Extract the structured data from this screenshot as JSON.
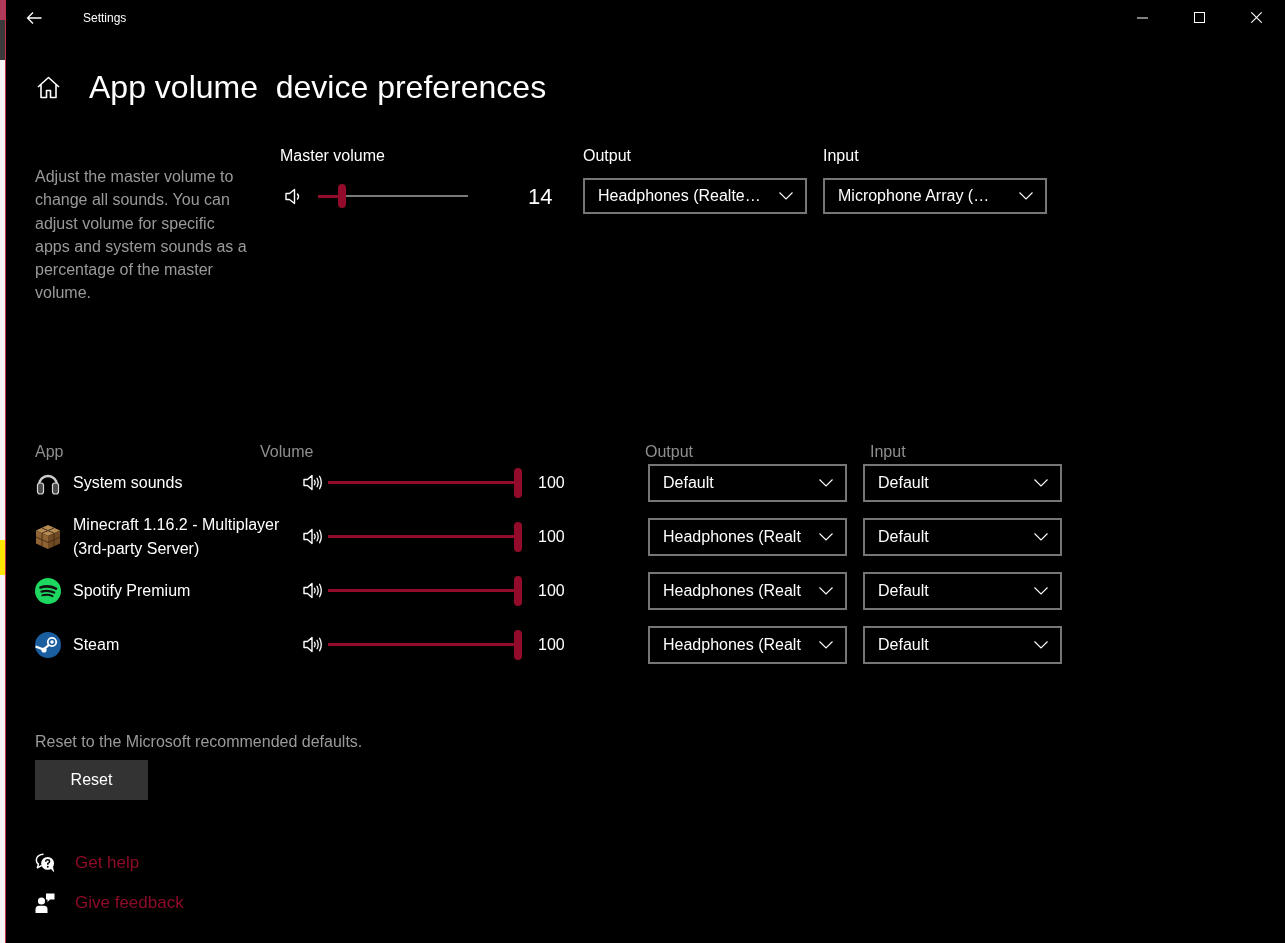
{
  "window": {
    "title": "Settings"
  },
  "page_title": "App volume  device preferences",
  "master": {
    "description": "Adjust the master volume to change all sounds. You can adjust volume for specific apps and system sounds as a percentage of the master volume.",
    "label": "Master volume",
    "level": 0.14,
    "reading": "14",
    "output": {
      "label": "Output",
      "value": "Headphones (Realte…"
    },
    "input": {
      "label": "Input",
      "value": "Microphone Array (…"
    }
  },
  "apps": {
    "columns": [
      "App",
      "Volume",
      "Output",
      "Input"
    ],
    "rows": [
      {
        "name": "System sounds",
        "level": 1,
        "reading": "100",
        "output": "Default",
        "input": "Default"
      },
      {
        "name": "Minecraft 1.16.2 - Multiplayer (3rd-party Server)",
        "level": 1,
        "reading": "100",
        "output": "Headphones (Realt",
        "input": "Default"
      },
      {
        "name": "Spotify Premium",
        "level": 1,
        "reading": "100",
        "output": "Headphones (Realt",
        "input": "Default"
      },
      {
        "name": "Steam",
        "level": 1,
        "reading": "100",
        "output": "Headphones (Realt",
        "input": "Default"
      }
    ]
  },
  "reset": {
    "hint": "Reset to the Microsoft recommended defaults.",
    "button": "Reset"
  },
  "links": [
    "Get help",
    "Give feedback"
  ]
}
